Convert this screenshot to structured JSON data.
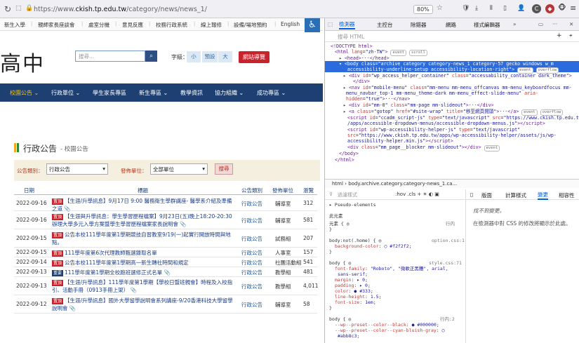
{
  "browser": {
    "url_prefix": "https://www.",
    "url_domain": "ckish.tp.edu.tw",
    "url_path": "/category/news/news_1/",
    "zoom": "80%"
  },
  "site": {
    "topnav": [
      "新生入學",
      "親師家長座談會",
      "處室分機",
      "意見反應",
      "校務行政系統",
      "線上報修",
      "設備/場地預約",
      "English"
    ],
    "logo_text": "高中",
    "search_placeholder": "搜尋...",
    "fontsize_label": "字級：",
    "fontsize_options": [
      "小",
      "預設",
      "大"
    ],
    "nav_guide": "網站導覽",
    "mainnav": [
      "校園公告 ⌄",
      "行政單位 ⌄",
      "學生家長專區",
      "新生專區 ⌄",
      "教學資訊",
      "協力組織 ⌄",
      "成功專區 ⌄"
    ],
    "section_title": "行政公告",
    "section_sub": "- 校園公告",
    "filter": {
      "cat_label": "公告類別：",
      "cat_value": "行政公告",
      "unit_label": "發佈單位：",
      "unit_value": "全部單位",
      "search": "搜尋"
    },
    "table": {
      "headers": [
        "日期",
        "標題",
        "公告類別",
        "發佈單位",
        "瀏覽"
      ],
      "rows": [
        {
          "date": "2022-09-16",
          "badge": "置頂",
          "title": "【生涯/升學訊息】9月17日 9:00 醫務衛生學群講座- 醫學系介紹及準備之道 📎",
          "cat": "行政公告",
          "unit": "輔導室",
          "views": "312"
        },
        {
          "date": "2022-09-16",
          "badge": "置頂",
          "title": "【生涯與升學訊息：學生學習歷程檔案】9月23日(五)晚上18:20-20:30辦理大學多元入學方案暨學生學習歷程檔案家長說明會 📎",
          "cat": "行政公告",
          "unit": "輔導室",
          "views": "581"
        },
        {
          "date": "2022-09-15",
          "badge": "置頂",
          "title": "公告本校111學年度第1學期競技自習教室9/19(一)起實行開放時間與地點。",
          "cat": "行政公告",
          "unit": "試務組",
          "views": "207"
        },
        {
          "date": "2022-09-15",
          "badge": "置頂",
          "title": "111學年度第6次代理教師甄選錄取名單",
          "cat": "行政公告",
          "unit": "人事室",
          "views": "157"
        },
        {
          "date": "2022-09-14",
          "badge": "置頂",
          "title": "公告本校111學年度第1學期高一新生轉社時間和規定",
          "cat": "行政公告",
          "unit": "社團活動組",
          "views": "541"
        },
        {
          "date": "2022-09-13",
          "badge": "重要",
          "title": "111學年度第1學期全校跑班選修正式名單 📎",
          "cat": "行政公告",
          "unit": "教學組",
          "views": "481"
        },
        {
          "date": "2022-09-13",
          "badge": "置頂",
          "title": "【生涯/升學訊息】111學年度第1學期【學校日暨班親會】時程及入校指引、活動手冊（0913手冊上架） 📎",
          "cat": "行政公告",
          "unit": "教學組",
          "views": "4,011"
        },
        {
          "date": "2022-09-12",
          "badge": "置頂",
          "title": "【生涯/升學訊息】國外大學留學說明會系列講座-9/20香港科技大學留學說明會 📎",
          "cat": "行政公告",
          "unit": "輔導室",
          "views": "58"
        }
      ]
    }
  },
  "devtools": {
    "tabs": [
      "檢測器",
      "主控台",
      "除錯器",
      "網路",
      "樣式編輯器"
    ],
    "search_placeholder": "搜尋 HTML",
    "crumbs": "html  ›  body.archive.category.category-news_1.ca...",
    "rules_filter": "過濾樣式",
    "side_tabs": [
      "版面",
      "計算樣式",
      "變更",
      "相容性"
    ],
    "side_text_1": "找不到變更。",
    "side_text_2": "在檢測器中對 CSS 的修改將顯示於此處。",
    "pseudo": "Pseudo-elements",
    "this_element": "此元素"
  }
}
